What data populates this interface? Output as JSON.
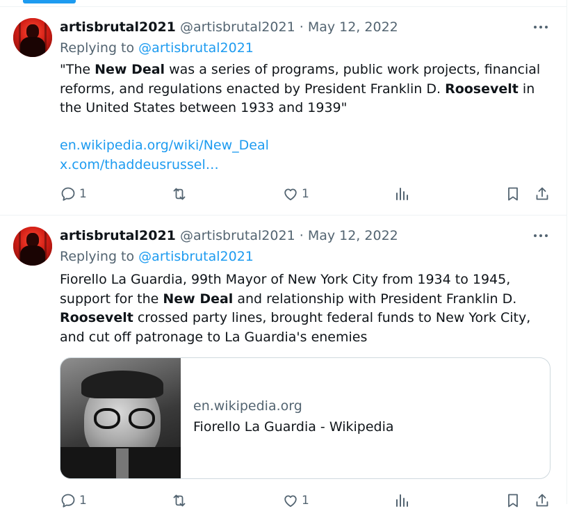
{
  "tweets": [
    {
      "display_name": "artisbrutal2021",
      "handle": "@artisbrutal2021",
      "separator": "·",
      "date": "May 12, 2022",
      "replying_prefix": "Replying to",
      "replying_handle": "@artisbrutal2021",
      "body_parts": [
        "\"The ",
        "New Deal",
        " was a series of programs, public work projects, financial reforms, and regulations enacted by President Franklin D. ",
        "Roosevelt",
        " in the United States between 1933 and 1939\""
      ],
      "links": [
        "en.wikipedia.org/wiki/New_Deal",
        "x.com/thaddeusrussel…"
      ],
      "reply_count": "1",
      "retweet_count": "",
      "like_count": "1"
    },
    {
      "display_name": "artisbrutal2021",
      "handle": "@artisbrutal2021",
      "separator": "·",
      "date": "May 12, 2022",
      "replying_prefix": "Replying to",
      "replying_handle": "@artisbrutal2021",
      "body_parts": [
        "Fiorello La Guardia,  99th Mayor of New York City from 1934 to 1945, support for the ",
        "New Deal",
        " and relationship with President Franklin D. ",
        "Roosevelt",
        " crossed party lines, brought federal funds to New York City, and cut off patronage to La Guardia's enemies"
      ],
      "card": {
        "domain": "en.wikipedia.org",
        "title": "Fiorello La Guardia - Wikipedia"
      },
      "reply_count": "1",
      "retweet_count": "",
      "like_count": "1"
    }
  ],
  "colors": {
    "accent": "#1d9bf0",
    "text": "#0f1419",
    "muted": "#536471",
    "border": "#eff3f4"
  },
  "icons": [
    "reply-icon",
    "retweet-icon",
    "like-icon",
    "views-icon",
    "bookmark-icon",
    "share-icon",
    "more-icon"
  ]
}
